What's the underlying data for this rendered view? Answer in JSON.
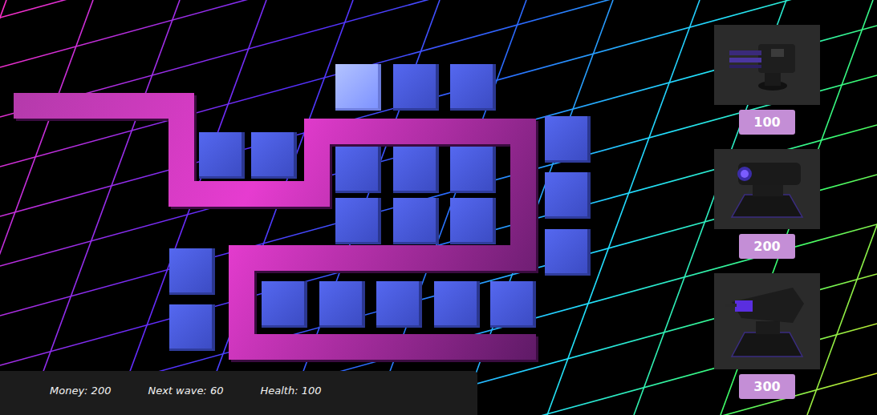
{
  "board": {
    "tiles": [
      {
        "highlighted": true
      },
      {
        "highlighted": false
      },
      {
        "highlighted": false
      },
      {
        "highlighted": false
      },
      {
        "highlighted": false
      },
      {
        "highlighted": false
      },
      {
        "highlighted": false
      },
      {
        "highlighted": false
      },
      {
        "highlighted": false
      },
      {
        "highlighted": false
      },
      {
        "highlighted": false
      },
      {
        "highlighted": false
      },
      {
        "highlighted": false
      },
      {
        "highlighted": false
      },
      {
        "highlighted": false
      },
      {
        "highlighted": false
      },
      {
        "highlighted": false
      },
      {
        "highlighted": false
      },
      {
        "highlighted": false
      },
      {
        "highlighted": false
      },
      {
        "highlighted": false
      }
    ]
  },
  "shop": {
    "towers": [
      {
        "kind": "gatling",
        "price": "100"
      },
      {
        "kind": "cannon",
        "price": "200"
      },
      {
        "kind": "laser",
        "price": "300"
      }
    ]
  },
  "hud": {
    "items": [
      "Money: 200",
      "Next wave: 60",
      "Health: 100"
    ]
  }
}
